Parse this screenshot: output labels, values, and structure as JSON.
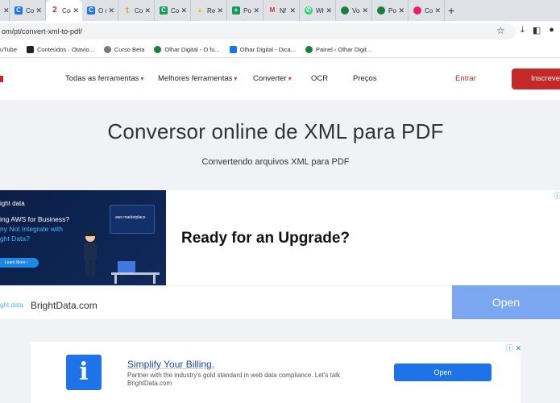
{
  "browser": {
    "tabs": [
      {
        "label": "Con",
        "favicon_color": "#1a73e8",
        "favicon": "C"
      },
      {
        "label": "Con",
        "favicon_color": "#c62828",
        "favicon": "2",
        "active": true
      },
      {
        "label": "O q",
        "favicon_color": "#1a73e8",
        "favicon": "C"
      },
      {
        "label": "Con",
        "favicon_color": "#e8a317",
        "favicon": "t"
      },
      {
        "label": "Con",
        "favicon_color": "#0f9d58",
        "favicon": "C"
      },
      {
        "label": "Rec",
        "favicon_color": "#fbbc04",
        "favicon": "▲"
      },
      {
        "label": "Pos",
        "favicon_color": "#0f9d58",
        "favicon": "+"
      },
      {
        "label": "Nf",
        "favicon_color": "#d93025",
        "favicon": "M"
      },
      {
        "label": "Wh",
        "favicon_color": "#25d366",
        "favicon": "W"
      },
      {
        "label": "Voc",
        "favicon_color": "#188038",
        "favicon": "●"
      },
      {
        "label": "Pos",
        "favicon_color": "#188038",
        "favicon": "●"
      },
      {
        "label": "Con",
        "favicon_color": "#e91e63",
        "favicon": "C"
      }
    ],
    "url": "om/pt/convert-xml-to-pdf/",
    "bookmarks": [
      {
        "label": "uTube",
        "color": "#ffffff"
      },
      {
        "label": "Conteúdos · Otavio...",
        "color": "#222222"
      },
      {
        "label": "Curso Beta",
        "color": "#555555"
      },
      {
        "label": "Olhar Digital - O fu...",
        "color": "#188038"
      },
      {
        "label": "Olhar Digital - Dica...",
        "color": "#1a73e8"
      },
      {
        "label": "Painel ‹ Olhar Digit...",
        "color": "#188038"
      }
    ]
  },
  "site_nav": {
    "items": [
      "Todas as ferramentas",
      "Melhores ferramentas",
      "Converter",
      "OCR",
      "Preços"
    ],
    "login": "Entrar",
    "signup": "Inscreve"
  },
  "hero": {
    "title": "Conversor online de XML para PDF",
    "subtitle": "Convertendo arquivos XML para PDF"
  },
  "ad1": {
    "brand": "ight data",
    "headline_1": "ing AWS for Business?",
    "headline_2": "ny Not Integrate with",
    "headline_3": "ght Data?",
    "learn": "Learn More ›",
    "marketplace": "aws marketplace",
    "title": "Ready for an Upgrade?",
    "logo_text": "ght data",
    "url": "BrightData.com",
    "button": "Open"
  },
  "ad2": {
    "title": "Simplify Your Billing.",
    "desc_line1": "Partner with the industry's gold standard in web data compliance. Let's talk",
    "desc_line2": "BrightData.com",
    "button": "Open",
    "close": "ⓘ ✕"
  }
}
